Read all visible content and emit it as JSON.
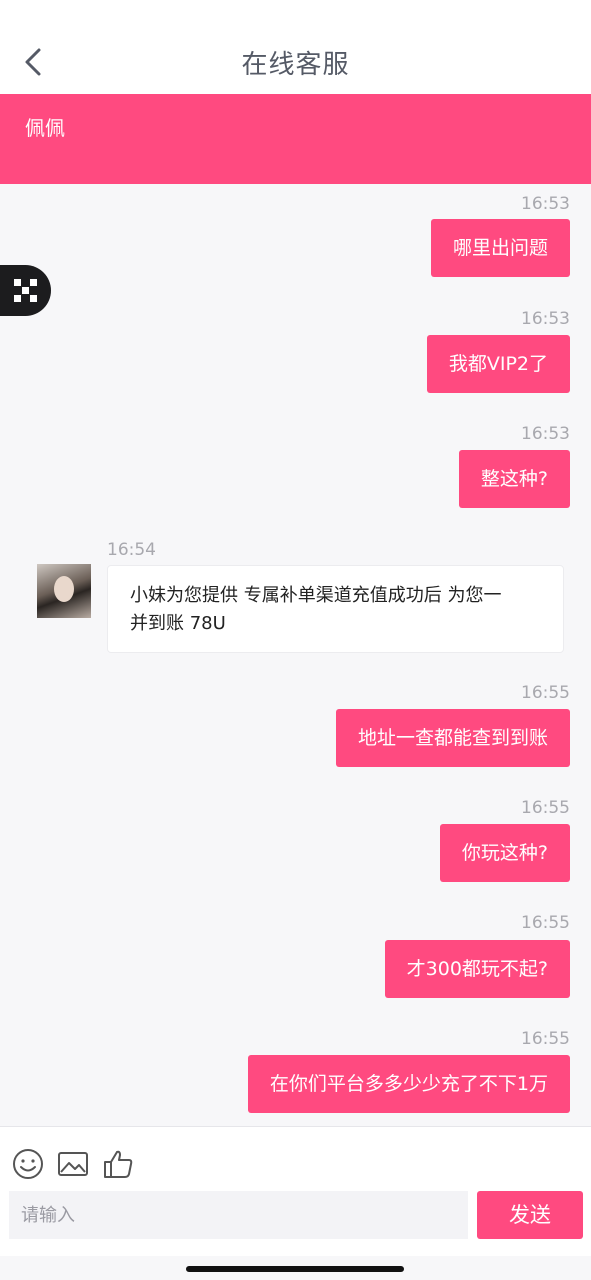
{
  "header": {
    "title": "在线客服",
    "back_icon": "chevron-left-icon"
  },
  "banner": {
    "name": "佩佩",
    "color": "#ff4a80"
  },
  "messages": [
    {
      "side": "out",
      "time": "16:53",
      "text": "哪里出问题"
    },
    {
      "side": "out",
      "time": "16:53",
      "text": "我都VIP2了"
    },
    {
      "side": "out",
      "time": "16:53",
      "text": "整这种?"
    },
    {
      "side": "in",
      "time": "16:54",
      "text": "小妹为您提供 专属补单渠道充值成功后 为您一并到账 78U",
      "line1": "小妹为您提供 专属补单渠道充值成功后 为您一",
      "line2": "并到账 78U"
    },
    {
      "side": "out",
      "time": "16:55",
      "text": "地址一查都能查到到账"
    },
    {
      "side": "out",
      "time": "16:55",
      "text": "你玩这种?"
    },
    {
      "side": "out",
      "time": "16:55",
      "text": "才300都玩不起?"
    },
    {
      "side": "out",
      "time": "16:55",
      "text": "在你们平台多多少少充了不下1万"
    }
  ],
  "toolbar": {
    "emoji_icon": "smiley-icon",
    "image_icon": "image-icon",
    "like_icon": "thumbs-up-icon"
  },
  "composer": {
    "placeholder": "请输入",
    "send_label": "发送"
  },
  "colors": {
    "accent": "#ff4a80",
    "timestamp": "#a8a8ae",
    "background": "#f7f7f9"
  }
}
